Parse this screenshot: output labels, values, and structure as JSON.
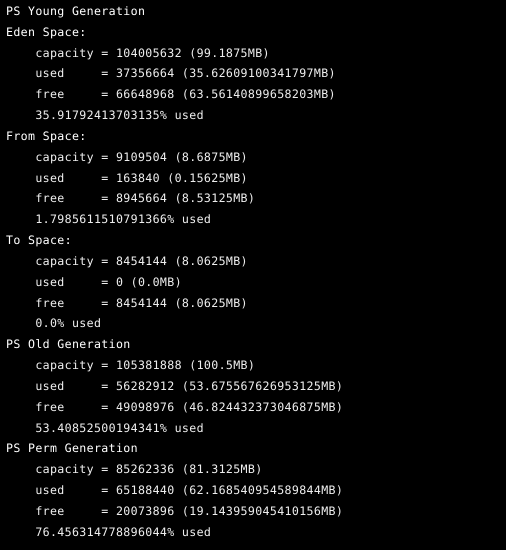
{
  "terminal": {
    "background_color": "#000000",
    "text_color": "#f2f2f2",
    "lines": [
      {
        "kind": "heading",
        "text": "PS Young Generation"
      },
      {
        "kind": "heading",
        "text": "Eden Space:"
      },
      {
        "kind": "detail",
        "text": "    capacity = 104005632 (99.1875MB)"
      },
      {
        "kind": "detail",
        "text": "    used     = 37356664 (35.62609100341797MB)"
      },
      {
        "kind": "detail",
        "text": "    free     = 66648968 (63.56140899658203MB)"
      },
      {
        "kind": "pct",
        "text": "    35.91792413703135% used"
      },
      {
        "kind": "heading",
        "text": "From Space:"
      },
      {
        "kind": "detail",
        "text": "    capacity = 9109504 (8.6875MB)"
      },
      {
        "kind": "detail",
        "text": "    used     = 163840 (0.15625MB)"
      },
      {
        "kind": "detail",
        "text": "    free     = 8945664 (8.53125MB)"
      },
      {
        "kind": "pct",
        "text": "    1.7985611510791366% used"
      },
      {
        "kind": "heading",
        "text": "To Space:"
      },
      {
        "kind": "detail",
        "text": "    capacity = 8454144 (8.0625MB)"
      },
      {
        "kind": "detail",
        "text": "    used     = 0 (0.0MB)"
      },
      {
        "kind": "detail",
        "text": "    free     = 8454144 (8.0625MB)"
      },
      {
        "kind": "pct",
        "text": "    0.0% used"
      },
      {
        "kind": "heading",
        "text": "PS Old Generation"
      },
      {
        "kind": "detail",
        "text": "    capacity = 105381888 (100.5MB)"
      },
      {
        "kind": "detail",
        "text": "    used     = 56282912 (53.675567626953125MB)"
      },
      {
        "kind": "detail",
        "text": "    free     = 49098976 (46.824432373046875MB)"
      },
      {
        "kind": "pct",
        "text": "    53.40852500194341% used"
      },
      {
        "kind": "heading",
        "text": "PS Perm Generation"
      },
      {
        "kind": "detail",
        "text": "    capacity = 85262336 (81.3125MB)"
      },
      {
        "kind": "detail",
        "text": "    used     = 65188440 (62.168540954589844MB)"
      },
      {
        "kind": "detail",
        "text": "    free     = 20073896 (19.143959045410156MB)"
      },
      {
        "kind": "pct",
        "text": "    76.456314778896044% used"
      }
    ],
    "memory_pools": [
      {
        "name": "PS Young Generation",
        "spaces": [
          {
            "space_name": "Eden Space:",
            "capacity_bytes": "104005632",
            "capacity_mb": "99.1875MB",
            "used_bytes": "37356664",
            "used_mb": "35.62609100341797MB",
            "free_bytes": "66648968",
            "free_mb": "63.56140899658203MB",
            "percent_used": "35.91792413703135% used"
          },
          {
            "space_name": "From Space:",
            "capacity_bytes": "9109504",
            "capacity_mb": "8.6875MB",
            "used_bytes": "163840",
            "used_mb": "0.15625MB",
            "free_bytes": "8945664",
            "free_mb": "8.53125MB",
            "percent_used": "1.7985611510791366% used"
          },
          {
            "space_name": "To Space:",
            "capacity_bytes": "8454144",
            "capacity_mb": "8.0625MB",
            "used_bytes": "0",
            "used_mb": "0.0MB",
            "free_bytes": "8454144",
            "free_mb": "8.0625MB",
            "percent_used": "0.0% used"
          }
        ]
      },
      {
        "name": "PS Old Generation",
        "spaces": [
          {
            "space_name": "",
            "capacity_bytes": "105381888",
            "capacity_mb": "100.5MB",
            "used_bytes": "56282912",
            "used_mb": "53.675567626953125MB",
            "free_bytes": "49098976",
            "free_mb": "46.824432373046875MB",
            "percent_used": "53.40852500194341% used"
          }
        ]
      },
      {
        "name": "PS Perm Generation",
        "spaces": [
          {
            "space_name": "",
            "capacity_bytes": "85262336",
            "capacity_mb": "81.3125MB",
            "used_bytes": "65188440",
            "used_mb": "62.168540954589844MB",
            "free_bytes": "20073896",
            "free_mb": "19.143959045410156MB",
            "percent_used": "76.456314778896044% used"
          }
        ]
      }
    ],
    "field_labels": {
      "capacity": "capacity",
      "used": "used",
      "free": "free",
      "equals": "=",
      "used_suffix": "used"
    }
  }
}
